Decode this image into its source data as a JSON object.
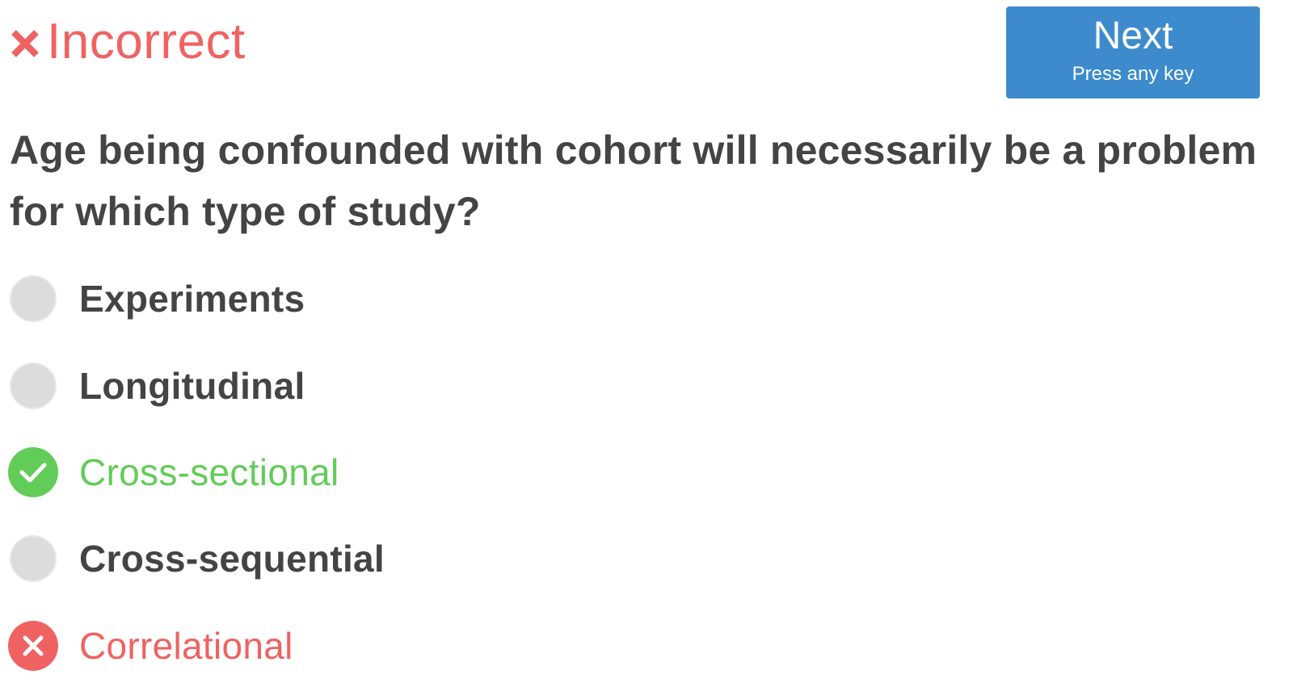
{
  "feedback": {
    "icon": "close-icon",
    "text": "Incorrect",
    "color": "#f06262"
  },
  "next_button": {
    "label": "Next",
    "hint": "Press any key",
    "color": "#3d8bcc"
  },
  "question": {
    "text": "Age being confounded with cohort will necessarily be a problem for which type of study?"
  },
  "options": [
    {
      "label": "Experiments",
      "state": "unselected"
    },
    {
      "label": "Longitudinal",
      "state": "unselected"
    },
    {
      "label": "Cross-sectional",
      "state": "correct",
      "icon": "check-icon",
      "color": "#62cc58"
    },
    {
      "label": "Cross-sequential",
      "state": "unselected"
    },
    {
      "label": "Correlational",
      "state": "incorrect",
      "icon": "close-icon",
      "color": "#f06262"
    }
  ]
}
